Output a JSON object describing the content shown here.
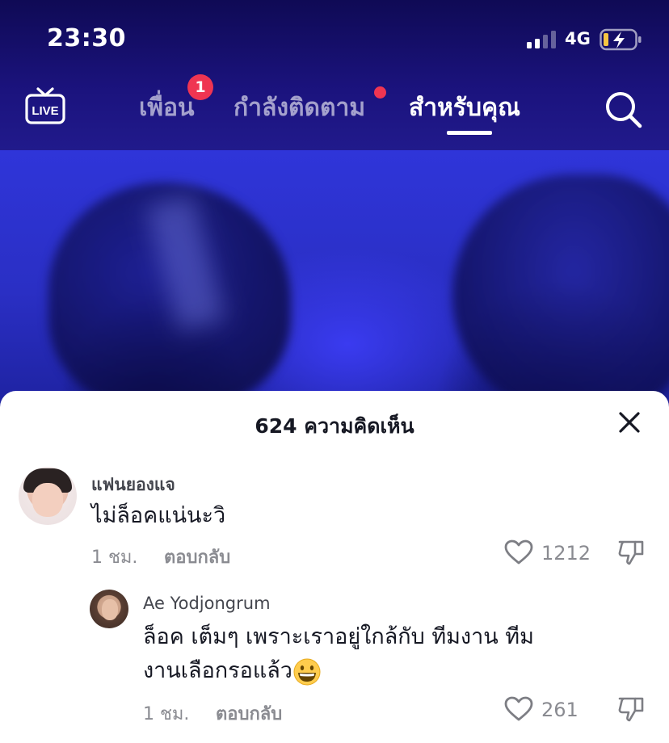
{
  "status_bar": {
    "time": "23:30",
    "network": "4G",
    "icons": [
      "signal-icon",
      "battery-charging-icon"
    ]
  },
  "nav": {
    "live_label": "LIVE",
    "tabs": [
      {
        "label": "เพื่อน",
        "badge": "1"
      },
      {
        "label": "กำลังติดตาม",
        "has_dot": true
      },
      {
        "label": "สำหรับคุณ",
        "active": true
      }
    ],
    "accent_color": "#ef3552"
  },
  "comments_sheet": {
    "title": "624 ความคิดเห็น",
    "comments": [
      {
        "username": "แฟนยองแจ",
        "text": "ไม่ล็อคแน่นะวิ",
        "time": "1 ชม.",
        "reply_label": "ตอบกลับ",
        "likes": "1212"
      },
      {
        "username": "Ae Yodjongrum",
        "text_line1": "ล็อค เต็มๆ เพราะเราอยู่ใกล้กับ ทีมงาน ทีม",
        "text_line2": "งานเลือกรอแล้ว",
        "emoji": "grinning-face-icon",
        "time": "1 ชม.",
        "reply_label": "ตอบกลับ",
        "likes": "261"
      }
    ]
  }
}
